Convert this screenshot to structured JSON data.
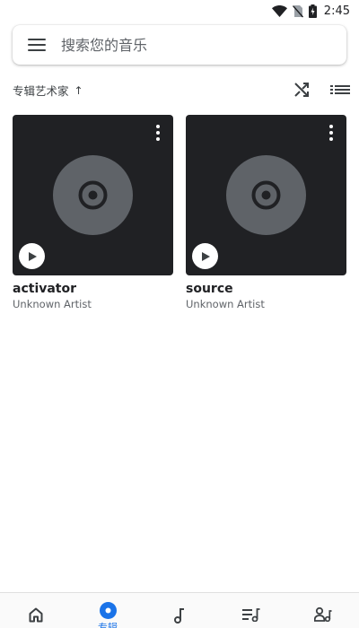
{
  "status_bar": {
    "time": "2:45",
    "icons": [
      "wifi-icon",
      "no-sim-icon",
      "battery-charging-icon"
    ]
  },
  "search": {
    "placeholder": "搜索您的音乐",
    "value": "",
    "icon": "menu-icon"
  },
  "sort": {
    "label": "专辑艺术家",
    "direction_icon": "arrow-up-icon",
    "actions": [
      "shuffle-icon",
      "list-view-icon"
    ]
  },
  "albums": [
    {
      "title": "activator",
      "artist": "Unknown Artist"
    },
    {
      "title": "source",
      "artist": "Unknown Artist"
    }
  ],
  "bottom_nav": {
    "items": [
      {
        "id": "home",
        "icon": "home-icon",
        "label": ""
      },
      {
        "id": "albums",
        "icon": "album-icon",
        "label": "专辑",
        "active": true
      },
      {
        "id": "songs",
        "icon": "music-note-icon",
        "label": ""
      },
      {
        "id": "playlists",
        "icon": "playlist-icon",
        "label": ""
      },
      {
        "id": "artists",
        "icon": "artist-icon",
        "label": ""
      }
    ]
  },
  "colors": {
    "accent": "#1a73e8",
    "album_bg": "#202124",
    "disc": "#5f6368",
    "text_primary": "#202124",
    "text_secondary": "#5f6368"
  }
}
